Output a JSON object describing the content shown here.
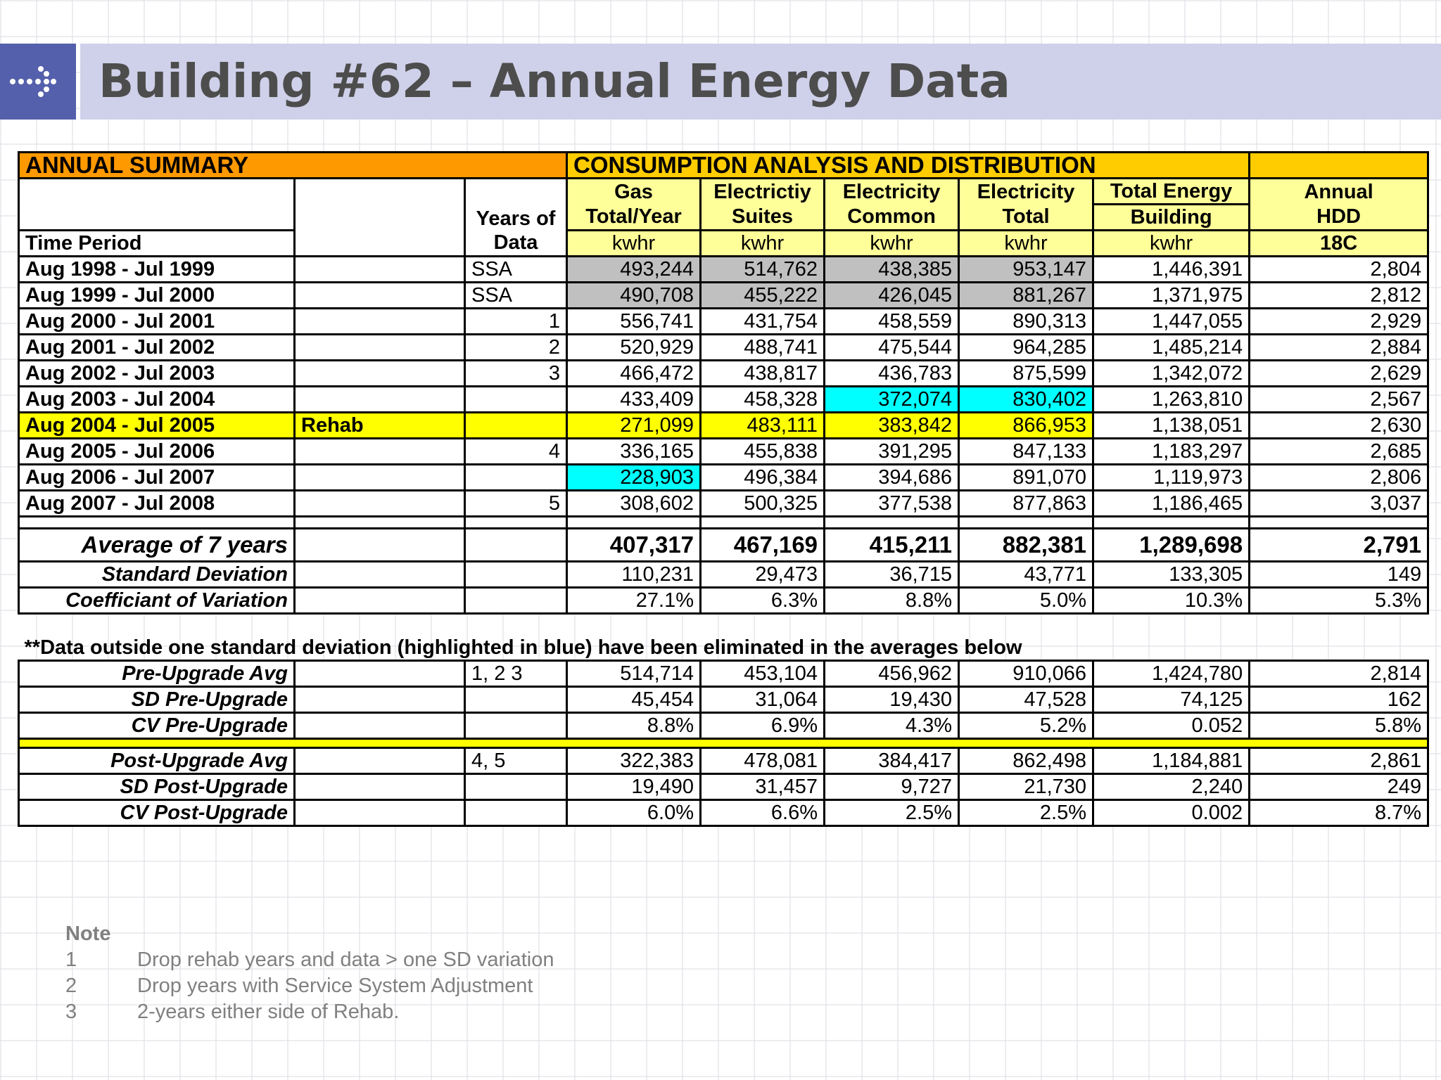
{
  "title": "Building #62 – Annual Energy Data",
  "header": {
    "annual_summary": "ANNUAL SUMMARY",
    "consumption": "CONSUMPTION ANALYSIS AND DISTRIBUTION",
    "years_of": "Years of",
    "data": "Data",
    "time_period": "Time Period",
    "gas_1": "Gas",
    "gas_2": "Total/Year",
    "es_1": "Electrictiy",
    "es_2": "Suites",
    "ec_1": "Electricity",
    "ec_2": "Common",
    "et_1": "Electricity",
    "et_2": "Total",
    "te_1": "Total Energy",
    "te_2": "Building",
    "hdd_1": "Annual",
    "hdd_2": "HDD",
    "hdd_unit": "18C",
    "unit": "kwhr"
  },
  "rows": [
    {
      "period": "Aug 1998 - Jul 1999",
      "note": "",
      "years": "SSA",
      "gas": "493,244",
      "suites": "514,762",
      "common": "438,385",
      "elec_total": "953,147",
      "total_energy": "1,446,391",
      "hdd": "2,804"
    },
    {
      "period": "Aug 1999 - Jul 2000",
      "note": "",
      "years": "SSA",
      "gas": "490,708",
      "suites": "455,222",
      "common": "426,045",
      "elec_total": "881,267",
      "total_energy": "1,371,975",
      "hdd": "2,812"
    },
    {
      "period": "Aug 2000 - Jul 2001",
      "note": "",
      "years": "1",
      "gas": "556,741",
      "suites": "431,754",
      "common": "458,559",
      "elec_total": "890,313",
      "total_energy": "1,447,055",
      "hdd": "2,929"
    },
    {
      "period": "Aug 2001 - Jul 2002",
      "note": "",
      "years": "2",
      "gas": "520,929",
      "suites": "488,741",
      "common": "475,544",
      "elec_total": "964,285",
      "total_energy": "1,485,214",
      "hdd": "2,884"
    },
    {
      "period": "Aug 2002 - Jul 2003",
      "note": "",
      "years": "3",
      "gas": "466,472",
      "suites": "438,817",
      "common": "436,783",
      "elec_total": "875,599",
      "total_energy": "1,342,072",
      "hdd": "2,629"
    },
    {
      "period": "Aug 2003 - Jul 2004",
      "note": "",
      "years": "",
      "gas": "433,409",
      "suites": "458,328",
      "common": "372,074",
      "elec_total": "830,402",
      "total_energy": "1,263,810",
      "hdd": "2,567"
    },
    {
      "period": "Aug 2004 - Jul 2005",
      "note": "Rehab",
      "years": "",
      "gas": "271,099",
      "suites": "483,111",
      "common": "383,842",
      "elec_total": "866,953",
      "total_energy": "1,138,051",
      "hdd": "2,630"
    },
    {
      "period": "Aug 2005 - Jul 2006",
      "note": "",
      "years": "4",
      "gas": "336,165",
      "suites": "455,838",
      "common": "391,295",
      "elec_total": "847,133",
      "total_energy": "1,183,297",
      "hdd": "2,685"
    },
    {
      "period": "Aug 2006 - Jul 2007",
      "note": "",
      "years": "",
      "gas": "228,903",
      "suites": "496,384",
      "common": "394,686",
      "elec_total": "891,070",
      "total_energy": "1,119,973",
      "hdd": "2,806"
    },
    {
      "period": "Aug 2007 - Jul 2008",
      "note": "",
      "years": "5",
      "gas": "308,602",
      "suites": "500,325",
      "common": "377,538",
      "elec_total": "877,863",
      "total_energy": "1,186,465",
      "hdd": "3,037"
    }
  ],
  "stats": [
    {
      "label": "Average of 7 years",
      "gas": "407,317",
      "suites": "467,169",
      "common": "415,211",
      "elec_total": "882,381",
      "total_energy": "1,289,698",
      "hdd": "2,791"
    },
    {
      "label": "Standard Deviation",
      "gas": "110,231",
      "suites": "29,473",
      "common": "36,715",
      "elec_total": "43,771",
      "total_energy": "133,305",
      "hdd": "149"
    },
    {
      "label": "Coefficiant of Variation",
      "gas": "27.1%",
      "suites": "6.3%",
      "common": "8.8%",
      "elec_total": "5.0%",
      "total_energy": "10.3%",
      "hdd": "5.3%"
    }
  ],
  "notice": "**Data outside one standard deviation (highlighted in blue) have been eliminated in the averages below",
  "pre": [
    {
      "label": "Pre-Upgrade Avg",
      "years": "1, 2 3",
      "gas": "514,714",
      "suites": "453,104",
      "common": "456,962",
      "elec_total": "910,066",
      "total_energy": "1,424,780",
      "hdd": "2,814"
    },
    {
      "label": "SD Pre-Upgrade",
      "years": "",
      "gas": "45,454",
      "suites": "31,064",
      "common": "19,430",
      "elec_total": "47,528",
      "total_energy": "74,125",
      "hdd": "162"
    },
    {
      "label": "CV Pre-Upgrade",
      "years": "",
      "gas": "8.8%",
      "suites": "6.9%",
      "common": "4.3%",
      "elec_total": "5.2%",
      "total_energy": "0.052",
      "hdd": "5.8%"
    }
  ],
  "post": [
    {
      "label": "Post-Upgrade Avg",
      "years": "4, 5",
      "gas": "322,383",
      "suites": "478,081",
      "common": "384,417",
      "elec_total": "862,498",
      "total_energy": "1,184,881",
      "hdd": "2,861"
    },
    {
      "label": "SD Post-Upgrade",
      "years": "",
      "gas": "19,490",
      "suites": "31,457",
      "common": "9,727",
      "elec_total": "21,730",
      "total_energy": "2,240",
      "hdd": "249"
    },
    {
      "label": "CV Post-Upgrade",
      "years": "",
      "gas": "6.0%",
      "suites": "6.6%",
      "common": "2.5%",
      "elec_total": "2.5%",
      "total_energy": "0.002",
      "hdd": "8.7%"
    }
  ],
  "notes": {
    "heading": "Note",
    "items": [
      {
        "n": "1",
        "text": "Drop rehab years and data > one SD variation"
      },
      {
        "n": "2",
        "text": "Drop years with Service System Adjustment"
      },
      {
        "n": "3",
        "text": "2-years either side of Rehab."
      }
    ]
  },
  "colors": {
    "title_band": "#cfd1ea",
    "arrow_box": "#5560ac",
    "orange_header": "#ff9900",
    "gold_header": "#ffcc00",
    "unit_row": "#ffff99",
    "ssa_gray": "#c0c0c0",
    "outlier_cyan": "#00ffff",
    "rehab_yellow": "#ffff00"
  }
}
